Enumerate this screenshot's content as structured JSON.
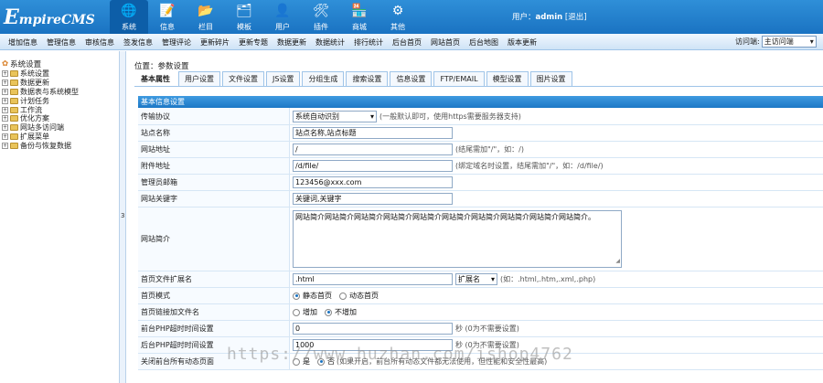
{
  "app": {
    "logo": "EmpireCMS",
    "logo_initial": "E",
    "logo_rest": "mpireCMS",
    "nav": [
      {
        "label": "系统",
        "icon": "globe-icon",
        "glyph": "🌐",
        "active": true
      },
      {
        "label": "信息",
        "icon": "document-icon",
        "glyph": "📝",
        "active": false
      },
      {
        "label": "栏目",
        "icon": "folder-icon",
        "glyph": "📂",
        "active": false
      },
      {
        "label": "模板",
        "icon": "template-icon",
        "glyph": "🗂",
        "active": false
      },
      {
        "label": "用户",
        "icon": "user-icon",
        "glyph": "👤",
        "active": false
      },
      {
        "label": "插件",
        "icon": "tools-icon",
        "glyph": "🛠",
        "active": false
      },
      {
        "label": "商城",
        "icon": "shop-icon",
        "glyph": "🏪",
        "active": false
      },
      {
        "label": "其他",
        "icon": "gear-icon",
        "glyph": "⚙",
        "active": false
      }
    ],
    "user_prefix": "用户：",
    "user_name": "admin",
    "logout": "[退出]"
  },
  "subnav": {
    "items": [
      "增加信息",
      "管理信息",
      "审核信息",
      "签发信息",
      "管理评论",
      "更新碎片",
      "更新专题",
      "数据更新",
      "数据统计",
      "排行统计",
      "后台首页",
      "网站首页",
      "后台地图",
      "版本更新"
    ],
    "visit_label": "访问端:",
    "visit_value": "主访问端"
  },
  "sidebar": {
    "title": "系统设置",
    "items": [
      "系统设置",
      "数据更新",
      "数据表与系统模型",
      "计划任务",
      "工作流",
      "优化方案",
      "网站多访问端",
      "扩展菜单",
      "备份与恢复数据"
    ]
  },
  "main": {
    "breadcrumb_prefix": "位置：",
    "breadcrumb_link": "参数设置",
    "tabs": [
      "基本属性",
      "用户设置",
      "文件设置",
      "JS设置",
      "分组生成",
      "搜索设置",
      "信息设置",
      "FTP/EMAIL",
      "模型设置",
      "图片设置"
    ],
    "section_title": "基本信息设置",
    "fields": {
      "protocol": {
        "label": "传输协议",
        "value": "系统自动识别",
        "hint": "(一般默认即可，使用https需要服务器支持)"
      },
      "site_name": {
        "label": "站点名称",
        "value": "站点名称,站点标题"
      },
      "site_url": {
        "label": "网站地址",
        "value": "/",
        "hint": "(结尾需加\"/\"，如：/)"
      },
      "file_url": {
        "label": "附件地址",
        "value": "/d/file/",
        "hint": "(绑定域名时设置，结尾需加\"/\"，如：/d/file/)"
      },
      "admin_email": {
        "label": "管理员邮箱",
        "value": "123456@xxx.com"
      },
      "keywords": {
        "label": "网站关键字",
        "value": "关键词,关键字"
      },
      "description": {
        "label": "网站简介",
        "value": "网站简介网站简介网站简介网站简介网站简介网站简介网站简介网站简介网站简介网站简介。"
      },
      "index_ext": {
        "label": "首页文件扩展名",
        "value": ".html",
        "select": "扩展名",
        "hint": "(如：.html,.htm,.xml,.php)"
      },
      "index_mode": {
        "label": "首页模式",
        "option_a": "静态首页",
        "option_b": "动态首页"
      },
      "index_link": {
        "label": "首页链接加文件名",
        "option_a": "增加",
        "option_b": "不增加"
      },
      "front_timeout": {
        "label": "前台PHP超时时间设置",
        "value": "0",
        "hint": "秒 (0为不需要设置)"
      },
      "back_timeout": {
        "label": "后台PHP超时时间设置",
        "value": "1000",
        "hint": "秒 (0为不需要设置)"
      },
      "close_dynamic": {
        "label": "关闭前台所有动态页面",
        "option_a": "是",
        "option_b": "否",
        "hint": "(如果开启，前台所有动态文件都无法使用，但性能和安全性最高)"
      }
    }
  },
  "watermark": "https://www.huzhan.com/ishop4762",
  "colors": {
    "accent": "#1a73c2",
    "header_dark": "#0d5ea8",
    "border": "#9fc4e8"
  }
}
